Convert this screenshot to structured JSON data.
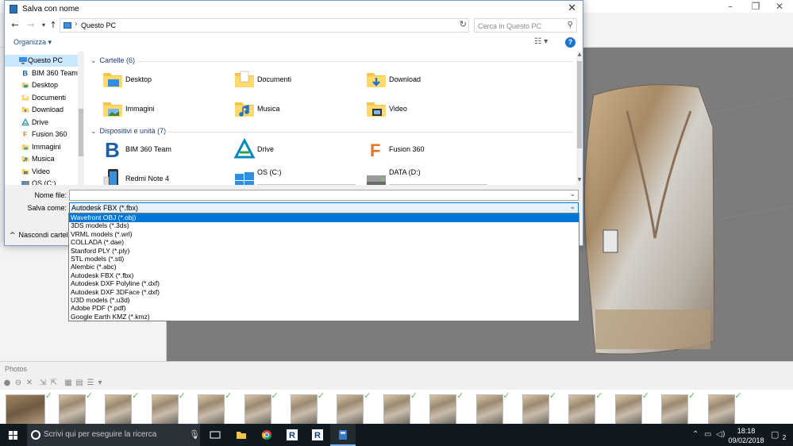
{
  "dialog": {
    "title": "Salva con nome",
    "close_glyph": "✕",
    "address": "Questo PC",
    "search_placeholder": "Cerca in Questo PC",
    "organize_label": "Organizza ▾",
    "help_label": "?"
  },
  "navpane": {
    "items": [
      {
        "label": "Questo PC",
        "icon": "pc-icon",
        "selected": true
      },
      {
        "label": "BIM 360 Team",
        "icon": "bim360-icon"
      },
      {
        "label": "Desktop",
        "icon": "desktop-folder-icon"
      },
      {
        "label": "Documenti",
        "icon": "documents-folder-icon"
      },
      {
        "label": "Download",
        "icon": "download-folder-icon"
      },
      {
        "label": "Drive",
        "icon": "drive-icon"
      },
      {
        "label": "Fusion 360",
        "icon": "fusion360-icon"
      },
      {
        "label": "Immagini",
        "icon": "pictures-folder-icon"
      },
      {
        "label": "Musica",
        "icon": "music-folder-icon"
      },
      {
        "label": "Video",
        "icon": "video-folder-icon"
      },
      {
        "label": "OS (C:)",
        "icon": "os-drive-icon"
      }
    ]
  },
  "content": {
    "folders_header": "Cartelle (6)",
    "folders": [
      "Desktop",
      "Documenti",
      "Download",
      "Immagini",
      "Musica",
      "Video"
    ],
    "devices_header": "Dispositivi e unità (7)",
    "devices": [
      {
        "label": "BIM 360 Team",
        "icon": "bim360-icon"
      },
      {
        "label": "Drive",
        "icon": "drive-icon"
      },
      {
        "label": "Fusion 360",
        "icon": "fusion360-icon"
      },
      {
        "label": "Redmi Note 4",
        "icon": "phone-icon"
      },
      {
        "label": "OS (C:)",
        "icon": "windows-drive-icon",
        "used_fraction": 0.78
      },
      {
        "label": "DATA (D:)",
        "icon": "hard-drive-icon",
        "used_fraction": 0.57
      }
    ]
  },
  "form": {
    "filename_label": "Nome file:",
    "filename_value": "",
    "savetype_label": "Salva come:",
    "savetype_value": "Autodesk FBX (*.fbx)",
    "hide_folders_label": "Nascondi cartelle"
  },
  "savetype_options": [
    "Wavefront OBJ (*.obj)",
    "3DS models (*.3ds)",
    "VRML models (*.wrl)",
    "COLLADA (*.dae)",
    "Stanford PLY (*.ply)",
    "STL models (*.stl)",
    "Alembic (*.abc)",
    "Autodesk FBX (*.fbx)",
    "Autodesk DXF Polyline (*.dxf)",
    "Autodesk DXF 3DFace (*.dxf)",
    "U3D models (*.u3d)",
    "Adobe PDF (*.pdf)",
    "Google Earth KMZ (*.kmz)"
  ],
  "highlighted_option_index": 0,
  "photos_panel": {
    "title": "Photos",
    "thumbnail_count": 16
  },
  "taskbar": {
    "search_placeholder": "Scrivi qui per eseguire la ricerca",
    "time": "18:18",
    "date": "09/02/2018",
    "notifications": "2"
  },
  "colors": {
    "accent": "#0078d7",
    "taskbar": "#101820",
    "checkmark": "#5cb85c"
  }
}
